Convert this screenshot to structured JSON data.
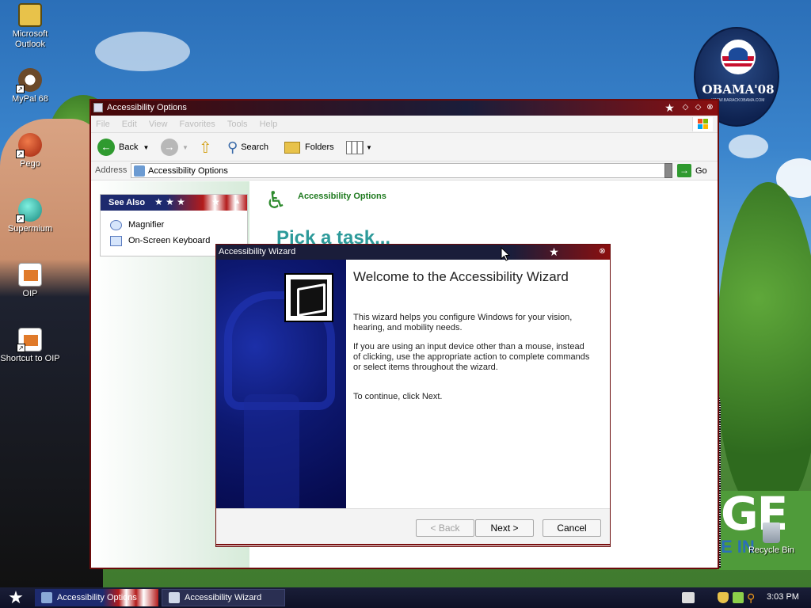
{
  "desktop": {
    "icons": [
      {
        "name": "microsoft-outlook",
        "label": "Microsoft Outlook",
        "shortcut": false,
        "color": "#e8c24a"
      },
      {
        "name": "mypal-68",
        "label": "MyPal 68",
        "shortcut": true,
        "color": "#6b4a2a"
      },
      {
        "name": "pego",
        "label": "Pego",
        "shortcut": true,
        "color": "#c0391f"
      },
      {
        "name": "supermium",
        "label": "Supermium",
        "shortcut": true,
        "color": "#2bb5a6"
      },
      {
        "name": "oip",
        "label": "OIP",
        "shortcut": false,
        "color": "#e07a2a"
      },
      {
        "name": "shortcut-to-oip",
        "label": "Shortcut to OIP",
        "shortcut": true,
        "color": "#e07a2a"
      }
    ],
    "recycle_bin": "Recycle Bin",
    "poster_brand": "OBAMA'08",
    "poster_url": "WWW.BARACKOBAMA.COM",
    "poster_text": "GE",
    "poster_text_2": "E IN"
  },
  "explorer": {
    "title": "Accessibility Options",
    "menu": [
      "File",
      "Edit",
      "View",
      "Favorites",
      "Tools",
      "Help"
    ],
    "toolbar": {
      "back": "Back",
      "search": "Search",
      "folders": "Folders"
    },
    "address": {
      "label": "Address",
      "value": "Accessibility Options",
      "go": "Go"
    },
    "see_also": {
      "heading": "See Also",
      "items": [
        "Magnifier",
        "On-Screen Keyboard"
      ]
    },
    "content": {
      "header": "Accessibility Options",
      "pick_task": "Pick a task..."
    }
  },
  "wizard": {
    "title": "Accessibility Wizard",
    "heading": "Welcome to the Accessibility Wizard",
    "para1": "This wizard helps you configure Windows for your vision, hearing, and mobility needs.",
    "para2": "If you are using an input device other than a mouse, instead of clicking, use the appropriate action to complete commands or select items throughout the wizard.",
    "para3": "To continue, click Next.",
    "buttons": {
      "back": "< Back",
      "next": "Next >",
      "cancel": "Cancel"
    }
  },
  "taskbar": {
    "tasks": [
      "Accessibility Options",
      "Accessibility Wizard"
    ],
    "clock": "3:03 PM"
  }
}
